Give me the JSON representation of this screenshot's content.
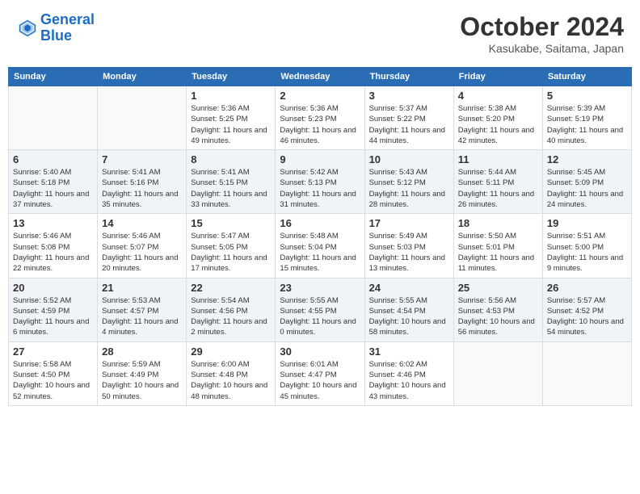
{
  "header": {
    "logo_line1": "General",
    "logo_line2": "Blue",
    "month": "October 2024",
    "location": "Kasukabe, Saitama, Japan"
  },
  "weekdays": [
    "Sunday",
    "Monday",
    "Tuesday",
    "Wednesday",
    "Thursday",
    "Friday",
    "Saturday"
  ],
  "weeks": [
    [
      {
        "day": "",
        "info": ""
      },
      {
        "day": "",
        "info": ""
      },
      {
        "day": "1",
        "info": "Sunrise: 5:36 AM\nSunset: 5:25 PM\nDaylight: 11 hours and 49 minutes."
      },
      {
        "day": "2",
        "info": "Sunrise: 5:36 AM\nSunset: 5:23 PM\nDaylight: 11 hours and 46 minutes."
      },
      {
        "day": "3",
        "info": "Sunrise: 5:37 AM\nSunset: 5:22 PM\nDaylight: 11 hours and 44 minutes."
      },
      {
        "day": "4",
        "info": "Sunrise: 5:38 AM\nSunset: 5:20 PM\nDaylight: 11 hours and 42 minutes."
      },
      {
        "day": "5",
        "info": "Sunrise: 5:39 AM\nSunset: 5:19 PM\nDaylight: 11 hours and 40 minutes."
      }
    ],
    [
      {
        "day": "6",
        "info": "Sunrise: 5:40 AM\nSunset: 5:18 PM\nDaylight: 11 hours and 37 minutes."
      },
      {
        "day": "7",
        "info": "Sunrise: 5:41 AM\nSunset: 5:16 PM\nDaylight: 11 hours and 35 minutes."
      },
      {
        "day": "8",
        "info": "Sunrise: 5:41 AM\nSunset: 5:15 PM\nDaylight: 11 hours and 33 minutes."
      },
      {
        "day": "9",
        "info": "Sunrise: 5:42 AM\nSunset: 5:13 PM\nDaylight: 11 hours and 31 minutes."
      },
      {
        "day": "10",
        "info": "Sunrise: 5:43 AM\nSunset: 5:12 PM\nDaylight: 11 hours and 28 minutes."
      },
      {
        "day": "11",
        "info": "Sunrise: 5:44 AM\nSunset: 5:11 PM\nDaylight: 11 hours and 26 minutes."
      },
      {
        "day": "12",
        "info": "Sunrise: 5:45 AM\nSunset: 5:09 PM\nDaylight: 11 hours and 24 minutes."
      }
    ],
    [
      {
        "day": "13",
        "info": "Sunrise: 5:46 AM\nSunset: 5:08 PM\nDaylight: 11 hours and 22 minutes."
      },
      {
        "day": "14",
        "info": "Sunrise: 5:46 AM\nSunset: 5:07 PM\nDaylight: 11 hours and 20 minutes."
      },
      {
        "day": "15",
        "info": "Sunrise: 5:47 AM\nSunset: 5:05 PM\nDaylight: 11 hours and 17 minutes."
      },
      {
        "day": "16",
        "info": "Sunrise: 5:48 AM\nSunset: 5:04 PM\nDaylight: 11 hours and 15 minutes."
      },
      {
        "day": "17",
        "info": "Sunrise: 5:49 AM\nSunset: 5:03 PM\nDaylight: 11 hours and 13 minutes."
      },
      {
        "day": "18",
        "info": "Sunrise: 5:50 AM\nSunset: 5:01 PM\nDaylight: 11 hours and 11 minutes."
      },
      {
        "day": "19",
        "info": "Sunrise: 5:51 AM\nSunset: 5:00 PM\nDaylight: 11 hours and 9 minutes."
      }
    ],
    [
      {
        "day": "20",
        "info": "Sunrise: 5:52 AM\nSunset: 4:59 PM\nDaylight: 11 hours and 6 minutes."
      },
      {
        "day": "21",
        "info": "Sunrise: 5:53 AM\nSunset: 4:57 PM\nDaylight: 11 hours and 4 minutes."
      },
      {
        "day": "22",
        "info": "Sunrise: 5:54 AM\nSunset: 4:56 PM\nDaylight: 11 hours and 2 minutes."
      },
      {
        "day": "23",
        "info": "Sunrise: 5:55 AM\nSunset: 4:55 PM\nDaylight: 11 hours and 0 minutes."
      },
      {
        "day": "24",
        "info": "Sunrise: 5:55 AM\nSunset: 4:54 PM\nDaylight: 10 hours and 58 minutes."
      },
      {
        "day": "25",
        "info": "Sunrise: 5:56 AM\nSunset: 4:53 PM\nDaylight: 10 hours and 56 minutes."
      },
      {
        "day": "26",
        "info": "Sunrise: 5:57 AM\nSunset: 4:52 PM\nDaylight: 10 hours and 54 minutes."
      }
    ],
    [
      {
        "day": "27",
        "info": "Sunrise: 5:58 AM\nSunset: 4:50 PM\nDaylight: 10 hours and 52 minutes."
      },
      {
        "day": "28",
        "info": "Sunrise: 5:59 AM\nSunset: 4:49 PM\nDaylight: 10 hours and 50 minutes."
      },
      {
        "day": "29",
        "info": "Sunrise: 6:00 AM\nSunset: 4:48 PM\nDaylight: 10 hours and 48 minutes."
      },
      {
        "day": "30",
        "info": "Sunrise: 6:01 AM\nSunset: 4:47 PM\nDaylight: 10 hours and 45 minutes."
      },
      {
        "day": "31",
        "info": "Sunrise: 6:02 AM\nSunset: 4:46 PM\nDaylight: 10 hours and 43 minutes."
      },
      {
        "day": "",
        "info": ""
      },
      {
        "day": "",
        "info": ""
      }
    ]
  ]
}
